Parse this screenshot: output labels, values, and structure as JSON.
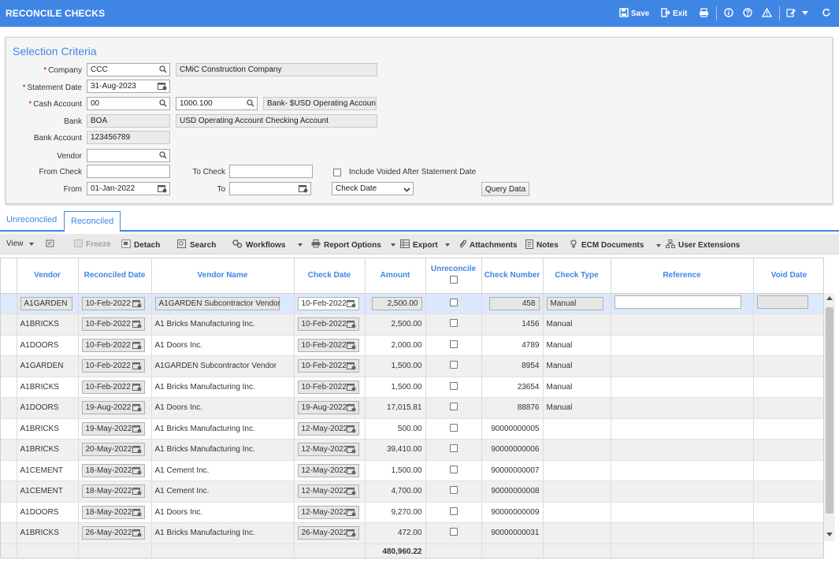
{
  "window": {
    "title": "RECONCILE CHECKS"
  },
  "toolbar_top": {
    "save": "Save",
    "exit": "Exit"
  },
  "criteria": {
    "title": "Selection Criteria",
    "company_label": "Company",
    "company_value": "CCC",
    "company_name": "CMiC Construction Company",
    "statement_date_label": "Statement Date",
    "statement_date_value": "31-Aug-2023",
    "cash_account_label": "Cash Account",
    "cash_account_value": "00",
    "cash_account_sub": "1000.100",
    "cash_account_name": "Bank- $USD Operating Account",
    "bank_label": "Bank",
    "bank_value": "BOA",
    "bank_name": "USD Operating Account Checking Account",
    "bank_account_label": "Bank Account",
    "bank_account_value": "123456789",
    "vendor_label": "Vendor",
    "vendor_value": "",
    "from_check_label": "From Check",
    "from_check_value": "",
    "to_check_label": "To Check",
    "to_check_value": "",
    "include_voided_label": "Include Voided After Statement Date",
    "from_label": "From",
    "from_value": "01-Jan-2022",
    "to_label": "To",
    "to_value": "",
    "date_type_value": "Check Date",
    "query_button": "Query Data"
  },
  "tabs": [
    {
      "label": "Unreconciled"
    },
    {
      "label": "Reconciled"
    }
  ],
  "grid_toolbar": {
    "view": "View",
    "freeze": "Freeze",
    "detach": "Detach",
    "search": "Search",
    "workflows": "Workflows",
    "report_options": "Report Options",
    "export": "Export",
    "attachments": "Attachments",
    "notes": "Notes",
    "ecm_documents": "ECM Documents",
    "user_extensions": "User Extensions"
  },
  "grid": {
    "columns": [
      "Vendor",
      "Reconciled Date",
      "Vendor Name",
      "Check Date",
      "Amount",
      "Unreconcile",
      "Check Number",
      "Check Type",
      "Reference",
      "Void Date"
    ],
    "rows": [
      [
        "A1GARDEN",
        "10-Feb-2022",
        "A1GARDEN Subcontractor Vendor",
        "10-Feb-2022",
        "2,500.00",
        "458",
        "Manual"
      ],
      [
        "A1BRICKS",
        "10-Feb-2022",
        "A1 Bricks Manufacturing Inc.",
        "10-Feb-2022",
        "2,500.00",
        "1456",
        "Manual"
      ],
      [
        "A1DOORS",
        "10-Feb-2022",
        "A1 Doors Inc.",
        "10-Feb-2022",
        "2,000.00",
        "4789",
        "Manual"
      ],
      [
        "A1GARDEN",
        "10-Feb-2022",
        "A1GARDEN Subcontractor Vendor",
        "10-Feb-2022",
        "1,500.00",
        "8954",
        "Manual"
      ],
      [
        "A1BRICKS",
        "10-Feb-2022",
        "A1 Bricks Manufacturing Inc.",
        "10-Feb-2022",
        "1,500.00",
        "23654",
        "Manual"
      ],
      [
        "A1DOORS",
        "19-Aug-2022",
        "A1 Doors Inc.",
        "19-Aug-2022",
        "17,015.81",
        "88876",
        "Manual"
      ],
      [
        "A1BRICKS",
        "19-May-2022",
        "A1 Bricks Manufacturing Inc.",
        "12-May-2022",
        "500.00",
        "90000000005",
        ""
      ],
      [
        "A1BRICKS",
        "20-May-2022",
        "A1 Bricks Manufacturing Inc.",
        "12-May-2022",
        "39,410.00",
        "90000000006",
        ""
      ],
      [
        "A1CEMENT",
        "18-May-2022",
        "A1 Cement Inc.",
        "12-May-2022",
        "1,500.00",
        "90000000007",
        ""
      ],
      [
        "A1CEMENT",
        "18-May-2022",
        "A1 Cement Inc.",
        "12-May-2022",
        "4,700.00",
        "90000000008",
        ""
      ],
      [
        "A1DOORS",
        "18-May-2022",
        "A1 Doors Inc.",
        "12-May-2022",
        "9,270.00",
        "90000000009",
        ""
      ],
      [
        "A1BRICKS",
        "26-May-2022",
        "A1 Bricks Manufacturing Inc.",
        "26-May-2022",
        "472.00",
        "90000000031",
        ""
      ]
    ],
    "total_amount": "480,960.22"
  }
}
